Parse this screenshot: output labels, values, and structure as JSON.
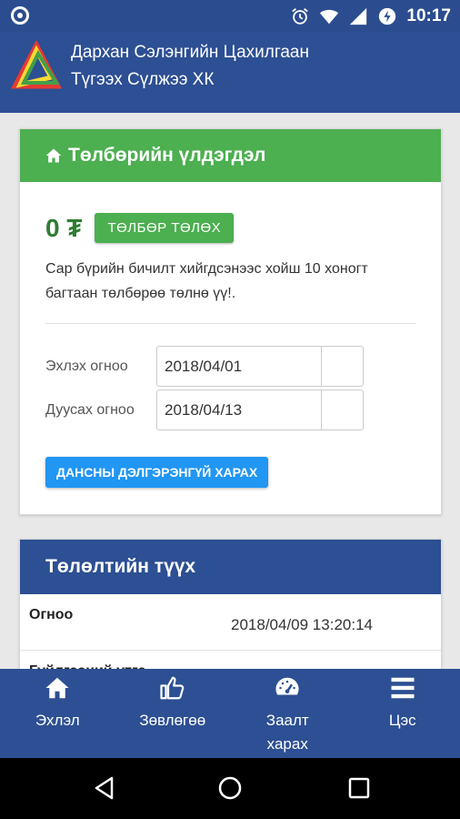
{
  "status_bar": {
    "time": "10:17",
    "icons": [
      "target-icon",
      "alarm-icon",
      "wifi-icon",
      "signal-icon",
      "battery-charging-icon"
    ]
  },
  "app": {
    "title_line1": "Дархан Сэлэнгийн Цахилгаан",
    "title_line2": "Түгээх Сүлжээ ХК"
  },
  "balance_card": {
    "title": "Төлбөрийн үлдэгдэл",
    "amount": "0 ₮",
    "pay_button": "ТӨЛБӨР ТӨЛӨХ",
    "note": "Сар бүрийн бичилт хийгдсэнээс хойш 10 хоногт багтаан төлбөрөө төлнө үү!.",
    "start_label": "Эхлэх огноо",
    "start_value": "2018/04/01",
    "end_label": "Дуусах огноо",
    "end_value": "2018/04/13",
    "detail_button": "ДАНСНЫ ДЭЛГЭРЭНГҮЙ ХАРАХ"
  },
  "history_card": {
    "title": "Төлөлтийн түүх",
    "rows": [
      {
        "key": "Огноо",
        "value": "2018/04/09 13:20:14"
      },
      {
        "key": "Гүйлгээний утга",
        "value": ""
      }
    ]
  },
  "tabs": [
    {
      "label": "Эхлэл",
      "icon": "home-icon"
    },
    {
      "label": "Зөвлөгөө",
      "icon": "thumbs-up-icon"
    },
    {
      "label": "Заалт харах",
      "icon": "gauge-icon"
    },
    {
      "label": "Цэс",
      "icon": "menu-icon"
    }
  ],
  "colors": {
    "primary": "#2d4f93",
    "success": "#4caf50",
    "info": "#2196f3",
    "balance_text": "#2e7d32"
  }
}
